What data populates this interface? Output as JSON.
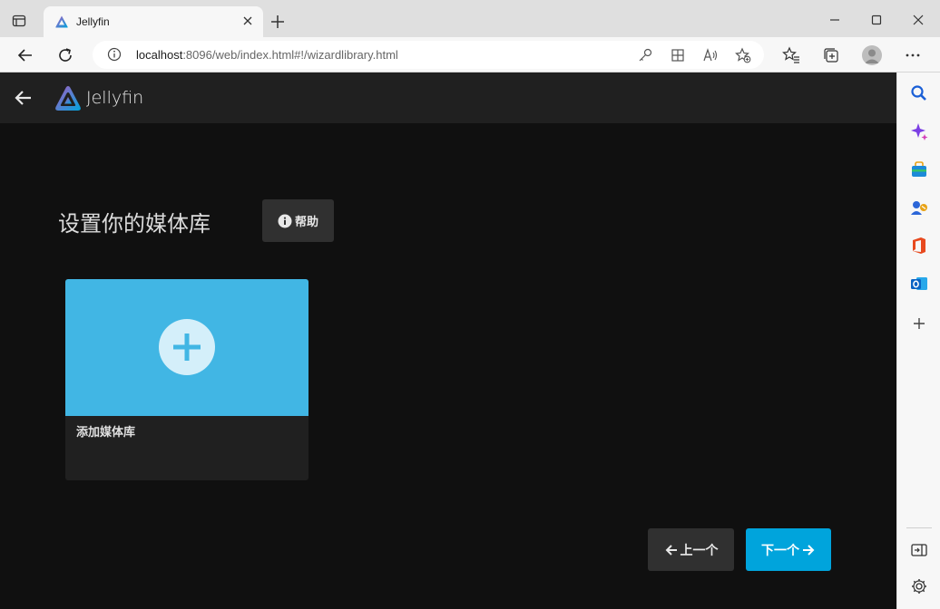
{
  "browser": {
    "tab_title": "Jellyfin",
    "url_host": "localhost",
    "url_rest": ":8096/web/index.html#!/wizardlibrary.html"
  },
  "app": {
    "brand": "Jellyfin",
    "page_title": "设置你的媒体库",
    "help_label": "帮助",
    "card_title": "添加媒体库",
    "prev_label": "上一个",
    "next_label": "下一个"
  },
  "colors": {
    "accent": "#00a4dc",
    "card_image": "#41b6e4",
    "app_bg": "#101010",
    "header_bg": "#202020"
  },
  "icons": {
    "sidebar": [
      "search-icon",
      "copilot-icon",
      "shopping-icon",
      "tools-icon",
      "office-icon",
      "outlook-icon",
      "add-icon",
      "hide-sidebar-icon",
      "settings-icon"
    ]
  }
}
